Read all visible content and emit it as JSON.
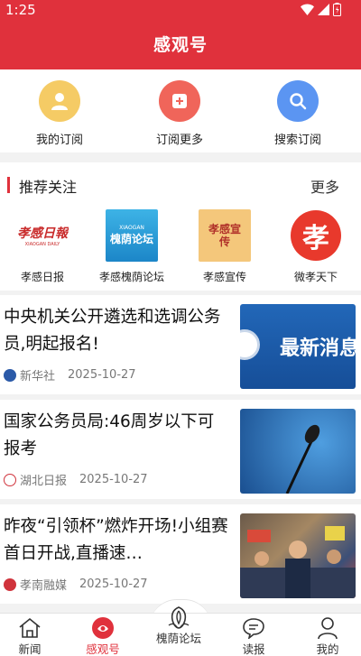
{
  "status": {
    "time": "1:25"
  },
  "header": {
    "title": "感观号"
  },
  "subscriptions": [
    {
      "label": "我的订阅",
      "icon": "user-icon",
      "color": "#f5cb65"
    },
    {
      "label": "订阅更多",
      "icon": "plus-icon",
      "color": "#f0655a"
    },
    {
      "label": "搜索订阅",
      "icon": "search-icon",
      "color": "#5b95f2"
    }
  ],
  "recommend": {
    "title": "推荐关注",
    "more": "更多",
    "items": [
      {
        "label": "孝感日报",
        "logo_text": "孝感日報",
        "logo_sub": "XIAOGAN DAILY"
      },
      {
        "label": "孝感槐荫论坛",
        "logo_text": "槐荫论坛",
        "logo_sub": "XIAOGAN"
      },
      {
        "label": "孝感宣传",
        "logo_text": "孝感宣传"
      },
      {
        "label": "微孝天下",
        "logo_text": "孝"
      }
    ]
  },
  "news": [
    {
      "headline": "中央机关公开遴选和选调公务员,明起报名!",
      "source": "新华社",
      "date": "2025-10-27",
      "thumb_text": "最新消息",
      "source_color": "#2b5aa8"
    },
    {
      "headline": "国家公务员局:46周岁以下可报考",
      "source": "湖北日报",
      "date": "2025-10-27",
      "source_color": "#d0333c"
    },
    {
      "headline": "昨夜“引领杯”燃炸开场!小组赛首日开战,直播速…",
      "source": "孝南融媒",
      "date": "2025-10-27",
      "source_color": "#d0333c"
    }
  ],
  "tabs": [
    {
      "label": "新闻",
      "icon": "home-icon"
    },
    {
      "label": "感观号",
      "icon": "ganguan-icon",
      "active": true
    },
    {
      "label": "槐荫论坛",
      "icon": "forum-icon"
    },
    {
      "label": "读报",
      "icon": "newspaper-icon"
    },
    {
      "label": "我的",
      "icon": "profile-icon"
    }
  ],
  "colors": {
    "brand": "#e0313c"
  }
}
